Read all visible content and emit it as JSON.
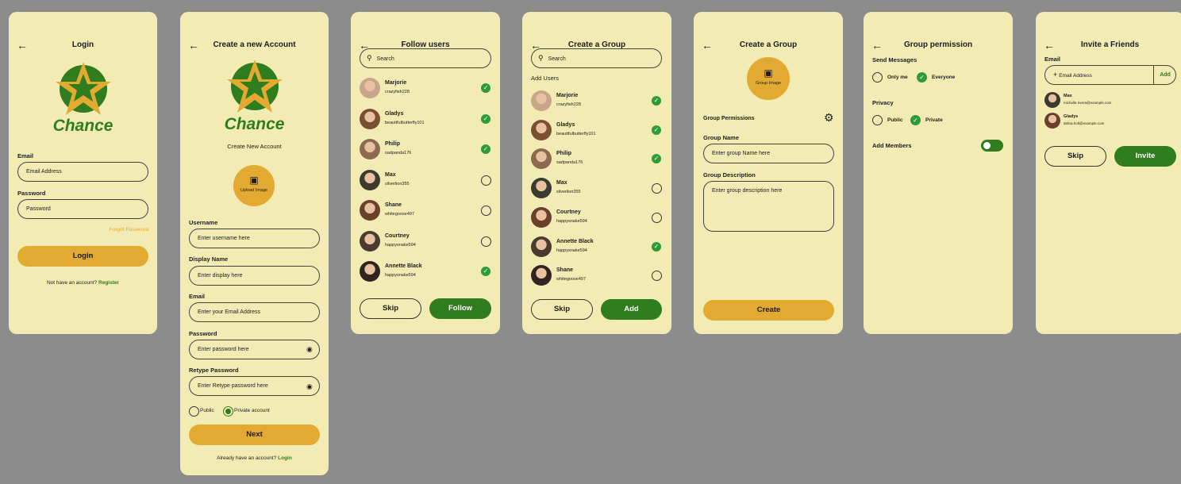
{
  "brand": {
    "name": "Chance",
    "green": "#2f7d1e",
    "yellow": "#e3aa32",
    "panel": "#f2ecb4"
  },
  "login": {
    "title": "Login",
    "email_label": "Email",
    "email_placeholder": "Email Address",
    "password_label": "Password",
    "password_placeholder": "Password",
    "forgot": "Forgot Password",
    "login_button": "Login",
    "no_account": "Not have an account?",
    "register": "Register"
  },
  "create_account": {
    "title": "Create a new Account",
    "subtitle": "Create New Account",
    "upload": "Upload Image",
    "username_label": "Username",
    "username_placeholder": "Enter username here",
    "display_label": "Display Name",
    "display_placeholder": "Enter display here",
    "email_label": "Email",
    "email_placeholder": "Enter your Email Address",
    "password_label": "Password",
    "password_placeholder": "Enter password here",
    "retype_label": "Retype Password",
    "retype_placeholder": "Enter Retype password here",
    "public": "Public",
    "private": "Private account",
    "next": "Next",
    "have_account": "Already have an account?",
    "login_link": "Login"
  },
  "follow": {
    "title": "Follow users",
    "search": "Search",
    "users": [
      {
        "name": "Marjorie",
        "handle": "crazyfish228",
        "checked": true
      },
      {
        "name": "Gladys",
        "handle": "beautifulbutterfly101",
        "checked": true
      },
      {
        "name": "Philip",
        "handle": "sadpanda176",
        "checked": true
      },
      {
        "name": "Max",
        "handle": "silverlion355",
        "checked": false
      },
      {
        "name": "Shane",
        "handle": "whitegoose497",
        "checked": false
      },
      {
        "name": "Courtney",
        "handle": "happysnake594",
        "checked": false
      },
      {
        "name": "Annette Black",
        "handle": "happysnake594",
        "checked": true
      }
    ],
    "skip": "Skip",
    "follow": "Follow"
  },
  "group_users": {
    "title": "Create a Group",
    "search": "Search",
    "add_users": "Add Users",
    "users": [
      {
        "name": "Marjorie",
        "handle": "crazyfish228",
        "checked": true
      },
      {
        "name": "Gladys",
        "handle": "beautifulbutterfly101",
        "checked": true
      },
      {
        "name": "Philip",
        "handle": "sadpanda176",
        "checked": true
      },
      {
        "name": "Max",
        "handle": "silverlion355",
        "checked": false
      },
      {
        "name": "Courtney",
        "handle": "happysnake594",
        "checked": false
      },
      {
        "name": "Annette Black",
        "handle": "happysnake594",
        "checked": true
      },
      {
        "name": "Shane",
        "handle": "whitegoose497",
        "checked": false
      }
    ],
    "skip": "Skip",
    "add": "Add"
  },
  "group_details": {
    "title": "Create a Group",
    "group_image": "Group Image",
    "permissions": "Group Permissions",
    "name_label": "Group Name",
    "name_placeholder": "Enter group Name  here",
    "desc_label": "Group Description",
    "desc_placeholder": "Enter group description  here",
    "create": "Create"
  },
  "group_permission": {
    "title": "Group permission",
    "send_messages": "Send Messages",
    "only_me": "Only me",
    "everyone": "Everyone",
    "privacy": "Privacy",
    "public": "Public",
    "private": "Private",
    "add_members": "Add Members"
  },
  "invite": {
    "title": "Invite a Friends",
    "email_label": "Email",
    "email_placeholder": "Email Address",
    "add": "Add",
    "invitees": [
      {
        "name": "Max",
        "email": "michelle.rivera@example.com"
      },
      {
        "name": "Gladys",
        "email": "debra.holt@example.com"
      }
    ],
    "skip": "Skip",
    "invite": "Invite"
  }
}
